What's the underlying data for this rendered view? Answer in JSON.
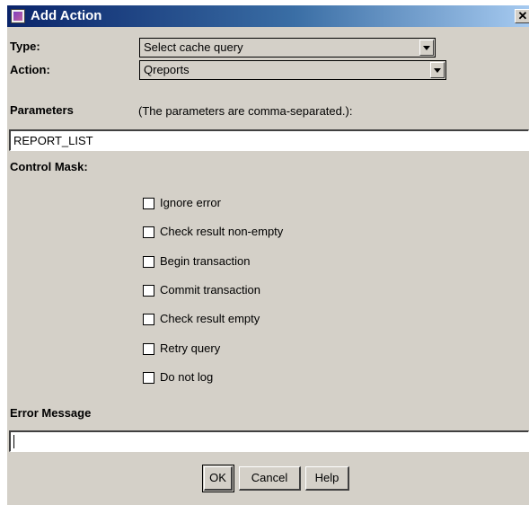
{
  "window": {
    "title": "Add Action"
  },
  "fields": {
    "type_label": "Type:",
    "type_value": "Select cache query",
    "action_label": "Action:",
    "action_value": "Qreports",
    "parameters_label": "Parameters",
    "parameters_hint": "(The parameters are comma-separated.):",
    "parameters_value": "REPORT_LIST",
    "control_mask_label": "Control Mask:",
    "error_message_label": "Error Message",
    "error_message_value": ""
  },
  "control_mask": [
    {
      "label": "Ignore error",
      "checked": false
    },
    {
      "label": "Check result non-empty",
      "checked": false
    },
    {
      "label": "Begin transaction",
      "checked": false
    },
    {
      "label": "Commit transaction",
      "checked": false
    },
    {
      "label": "Check result empty",
      "checked": false
    },
    {
      "label": "Retry query",
      "checked": false
    },
    {
      "label": "Do not log",
      "checked": false
    }
  ],
  "buttons": {
    "ok": "OK",
    "cancel": "Cancel",
    "help": "Help"
  }
}
